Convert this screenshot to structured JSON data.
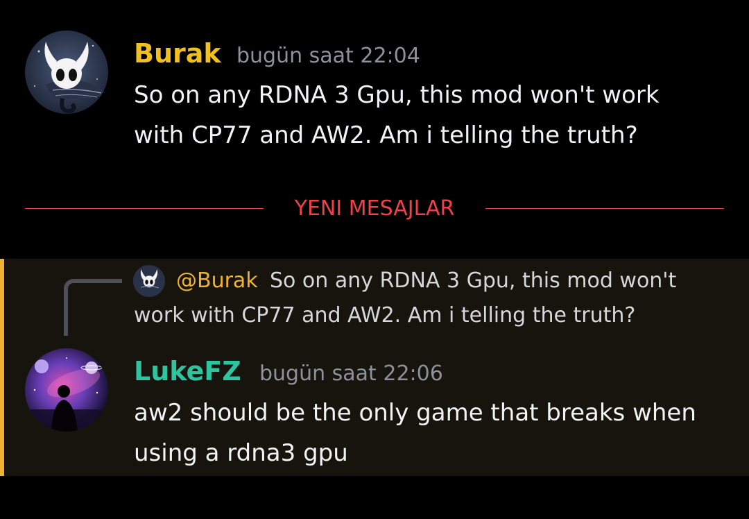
{
  "messages": [
    {
      "username": "Burak",
      "username_color": "#f0c020",
      "timestamp": "bugün saat 22:04",
      "text_lines": [
        "So on any RDNA 3 Gpu, this mod won't work",
        "with CP77 and AW2. Am i telling the truth?"
      ],
      "avatar_icon": "hollow-knight-avatar-icon"
    },
    {
      "username": "LukeFZ",
      "username_color": "#2ec4a0",
      "timestamp": "bugün saat 22:06",
      "text_lines": [
        "aw2 should be the only game that breaks when",
        "using a rdna3 gpu"
      ],
      "avatar_icon": "galaxy-silhouette-avatar-icon",
      "reply": {
        "mention": "@Burak",
        "text_lines": [
          "So on any RDNA 3 Gpu, this mod won't",
          "work with CP77 and AW2. Am i telling the truth?"
        ]
      }
    }
  ],
  "divider": {
    "label": "YENI MESAJLAR",
    "color": "#f0414a"
  },
  "highlight": {
    "bar_color": "#f0b232",
    "background": "#16140d"
  }
}
